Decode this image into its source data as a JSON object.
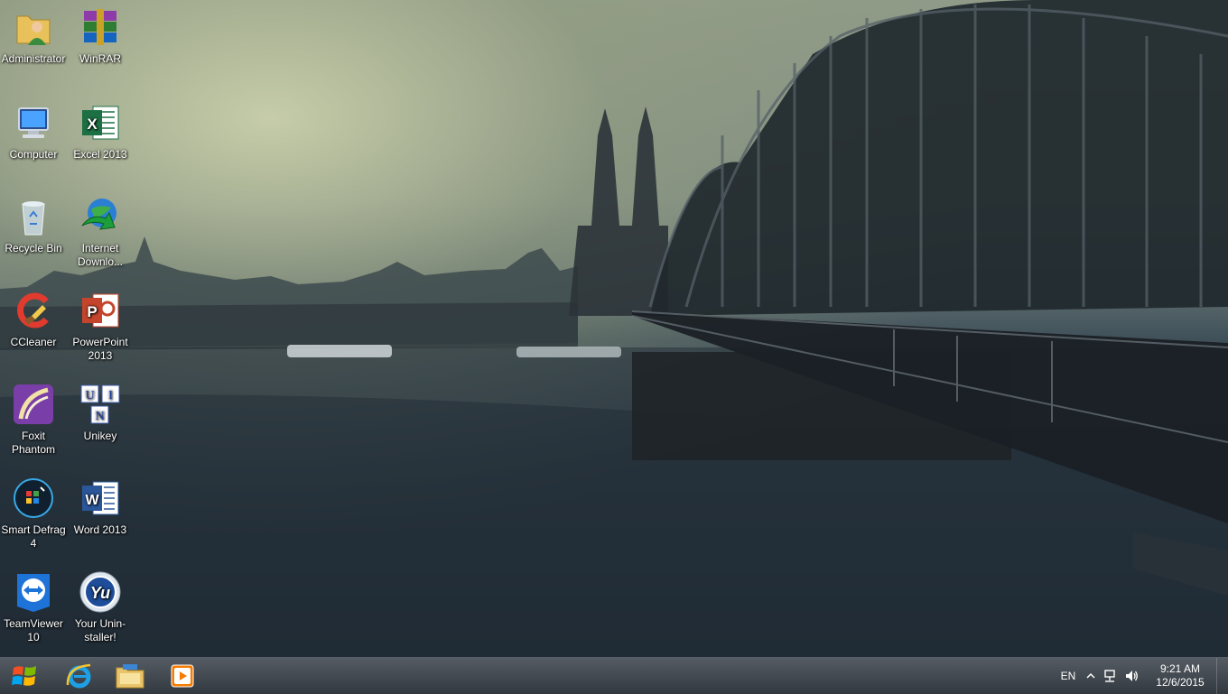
{
  "desktop_icons": [
    {
      "label": "Administrator",
      "icon": "user-folder-icon"
    },
    {
      "label": "WinRAR",
      "icon": "winrar-icon"
    },
    {
      "label": "Computer",
      "icon": "computer-icon"
    },
    {
      "label": "Excel 2013",
      "icon": "excel-icon"
    },
    {
      "label": "Recycle Bin",
      "icon": "recycle-bin-icon"
    },
    {
      "label": "Internet Downlo...",
      "icon": "internet-download-manager-icon"
    },
    {
      "label": "CCleaner",
      "icon": "ccleaner-icon"
    },
    {
      "label": "PowerPoint 2013",
      "icon": "powerpoint-icon"
    },
    {
      "label": "Foxit Phantom",
      "icon": "foxit-phantom-icon"
    },
    {
      "label": "Unikey",
      "icon": "unikey-icon"
    },
    {
      "label": "Smart Defrag 4",
      "icon": "smart-defrag-icon"
    },
    {
      "label": "Word 2013",
      "icon": "word-icon"
    },
    {
      "label": "TeamViewer 10",
      "icon": "teamviewer-icon"
    },
    {
      "label": "Your Unin-staller!",
      "icon": "your-uninstaller-icon"
    }
  ],
  "taskbar": {
    "pinned": [
      "start-orb-icon",
      "internet-explorer-icon",
      "file-explorer-icon",
      "media-player-icon"
    ],
    "tray": {
      "language": "EN",
      "time": "9:21 AM",
      "date": "12/6/2015"
    }
  },
  "colors": {
    "taskbar": "#2f363d",
    "icon_label": "#ffffff"
  }
}
